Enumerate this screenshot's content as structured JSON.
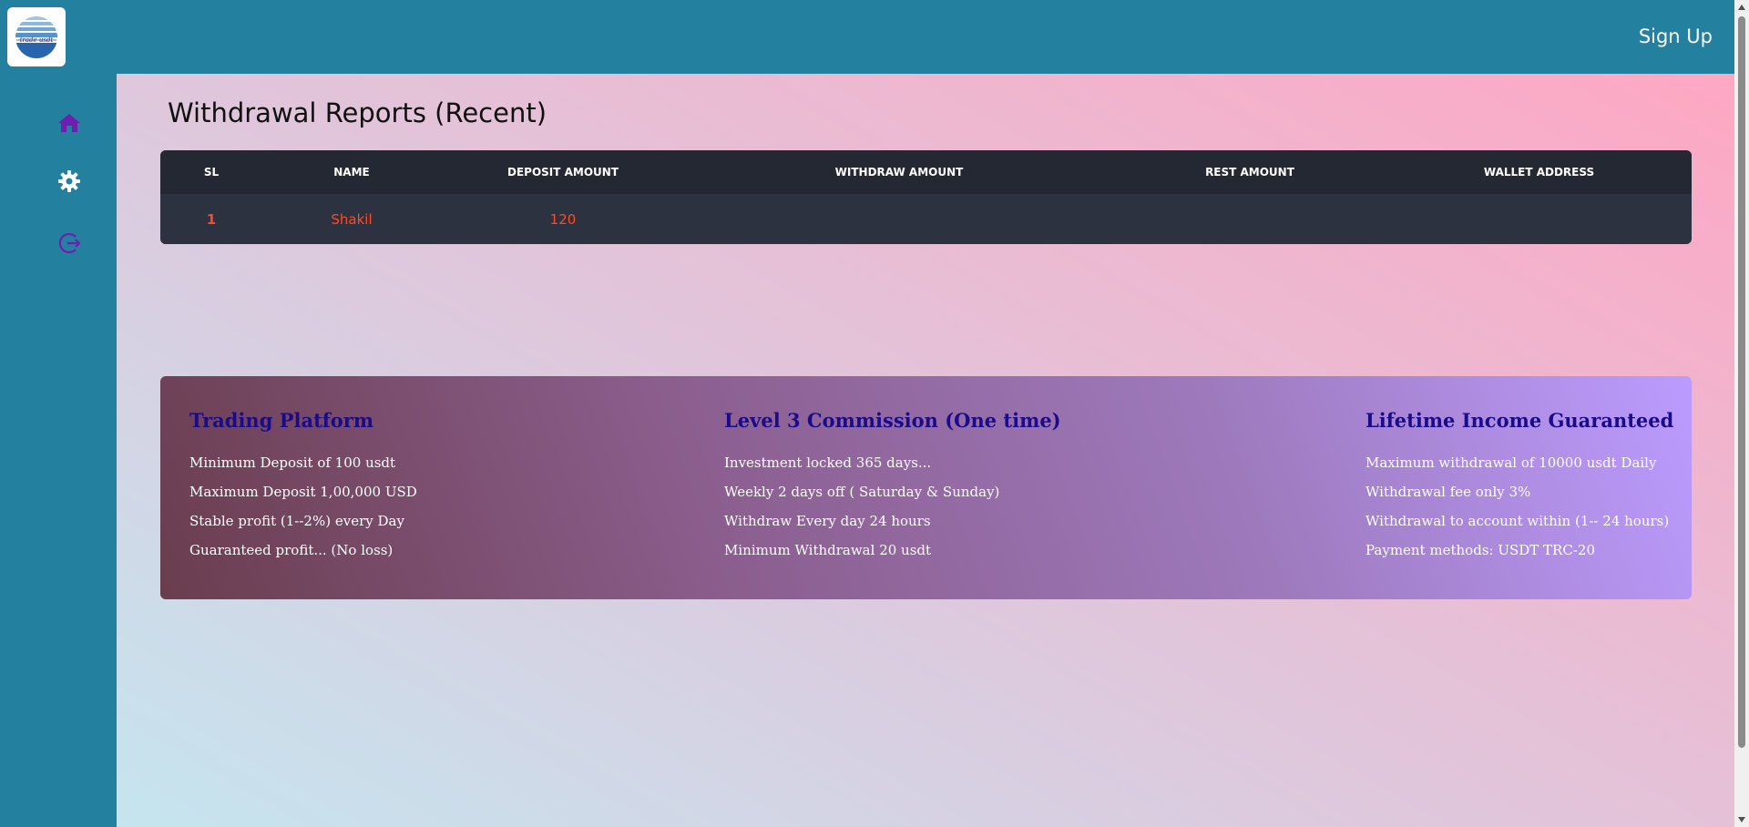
{
  "header": {
    "logo_text": "trade usdt",
    "signup_label": "Sign Up"
  },
  "sidebar": {
    "items": [
      {
        "icon": "home-icon"
      },
      {
        "icon": "gear-icon"
      },
      {
        "icon": "logout-icon"
      }
    ],
    "icon_color": "#6e1fb0"
  },
  "main": {
    "title": "Withdrawal Reports (Recent)",
    "table": {
      "columns": [
        "SL",
        "NAME",
        "DEPOSIT AMOUNT",
        "WITHDRAW AMOUNT",
        "REST AMOUNT",
        "WALLET ADDRESS"
      ],
      "rows": [
        {
          "sl": "1",
          "name": "Shakil",
          "deposit": "120",
          "withdraw": "",
          "rest": "",
          "wallet": ""
        }
      ]
    }
  },
  "info": {
    "columns": [
      {
        "heading": "Trading Platform",
        "lines": [
          "Minimum Deposit of 100 usdt",
          "Maximum Deposit 1,00,000 USD",
          "Stable profit (1--2%) every Day",
          "Guaranteed profit... (No loss)"
        ]
      },
      {
        "heading": "Level 3 Commission (One time)",
        "lines": [
          "Investment locked 365 days...",
          "Weekly 2 days off ( Saturday & Sunday)",
          "Withdraw Every day 24 hours",
          "Minimum Withdrawal 20 usdt"
        ]
      },
      {
        "heading": "Lifetime Income Guaranteed",
        "lines": [
          "Maximum withdrawal of 10000 usdt Daily",
          "Withdrawal fee only 3%",
          "Withdrawal to account within (1-- 24 hours)",
          "Payment methods: USDT TRC-20"
        ]
      }
    ]
  },
  "colors": {
    "topbar": "#24809f",
    "table_bg": "#282c38",
    "row_text": "#ff4a24",
    "heading_text": "#1b0a8a"
  }
}
